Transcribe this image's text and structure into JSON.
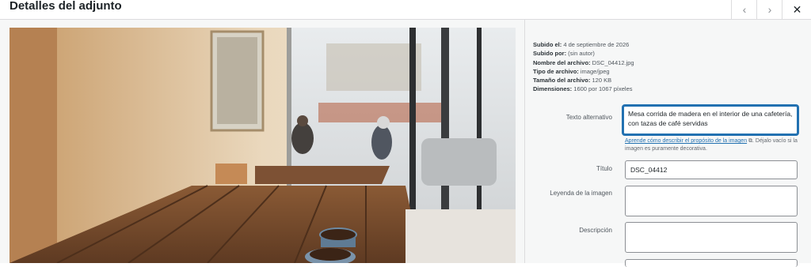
{
  "header": {
    "title": "Detalles del adjunto",
    "prev_icon": "‹",
    "next_icon": "›",
    "close_icon": "✕"
  },
  "meta": {
    "uploaded_label": "Subido el:",
    "uploaded_value": "4 de septiembre de 2026",
    "by_label": "Subido por:",
    "by_value": "(sin autor)",
    "filename_label": "Nombre del archivo:",
    "filename_value": "DSC_04412.jpg",
    "type_label": "Tipo de archivo:",
    "type_value": "image/jpeg",
    "size_label": "Tamaño del archivo:",
    "size_value": "120 KB",
    "dims_label": "Dimensiones:",
    "dims_value": "1600 por 1067 píxeles"
  },
  "fields": {
    "alt_label": "Texto alternativo",
    "alt_value": "Mesa corrida de madera en el interior de una cafetería, con tazas de café servidas",
    "alt_help_link": "Aprende cómo describir el propósito de la imagen",
    "alt_help_rest": ". Déjalo vacío si la imagen es puramente decorativa.",
    "title_label": "Título",
    "title_value": "DSC_04412",
    "caption_label": "Leyenda de la imagen",
    "caption_value": "",
    "description_label": "Descripción",
    "description_value": ""
  },
  "colors": {
    "accent": "#2271b1",
    "border": "#dcdcde"
  }
}
